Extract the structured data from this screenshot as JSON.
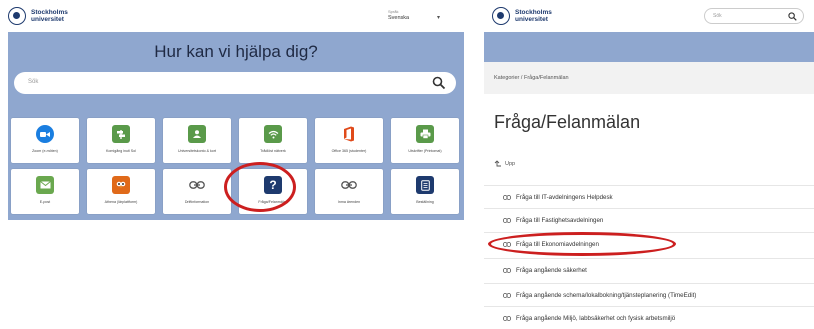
{
  "left": {
    "logo_line1": "Stockholms",
    "logo_line2": "universitet",
    "lang_label": "Språk",
    "lang_value": "Svenska",
    "hero_title": "Hur kan vi hjälpa dig?",
    "search_placeholder": "Sök",
    "tiles": [
      {
        "label": "Zoom (e-möten)",
        "icon": "video-camera-icon",
        "color": "#1a7ee0"
      },
      {
        "label": "Komigång inuti Sol",
        "icon": "sign-icon",
        "color": "#5a9a4a"
      },
      {
        "label": "Universitetskonto & kort",
        "icon": "user-card-icon",
        "color": "#5a9a4a"
      },
      {
        "label": "Trådlöst nätverk",
        "icon": "wifi-icon",
        "color": "#5a9a4a"
      },
      {
        "label": "Office 365 (studenter)",
        "icon": "office-icon",
        "color": "#e04a1a"
      },
      {
        "label": "Utskrifter (Printomat)",
        "icon": "printer-icon",
        "color": "#5a9a4a"
      },
      {
        "label": "E-post",
        "icon": "envelope-icon",
        "color": "#6aa84f"
      },
      {
        "label": "Athena (lärplattform)",
        "icon": "owl-icon",
        "color": "#e06a1a"
      },
      {
        "label": "Driftinformation",
        "icon": "link-icon",
        "color": "#666666"
      },
      {
        "label": "Fråga/Felanmälan",
        "icon": "question-icon",
        "color": "#1e3a6e"
      },
      {
        "label": "Inma ärenden",
        "icon": "link-icon",
        "color": "#666666"
      },
      {
        "label": "Beställning",
        "icon": "tablet-icon",
        "color": "#1e3a6e"
      }
    ]
  },
  "right": {
    "logo_line1": "Stockholms",
    "logo_line2": "universitet",
    "search_placeholder": "Sök",
    "breadcrumb": "Kategorier / Fråga/Felanmälan",
    "page_title": "Fråga/Felanmälan",
    "up_label": "Upp",
    "links": [
      "Fråga till IT-avdelningens Helpdesk",
      "Fråga till Fastighetsavdelningen",
      "Fråga till Ekonomiavdelningen",
      "Fråga angående säkerhet",
      "Fråga angående schema/lokalbokning/tjänsteplanering (TimeEdit)",
      "Fråga angående Miljö, labbsäkerhet och fysisk arbetsmiljö"
    ]
  },
  "colors": {
    "hero_blue": "#8fa7cf",
    "brand_navy": "#1e3a6e",
    "highlight_red": "#cc1f1f"
  }
}
